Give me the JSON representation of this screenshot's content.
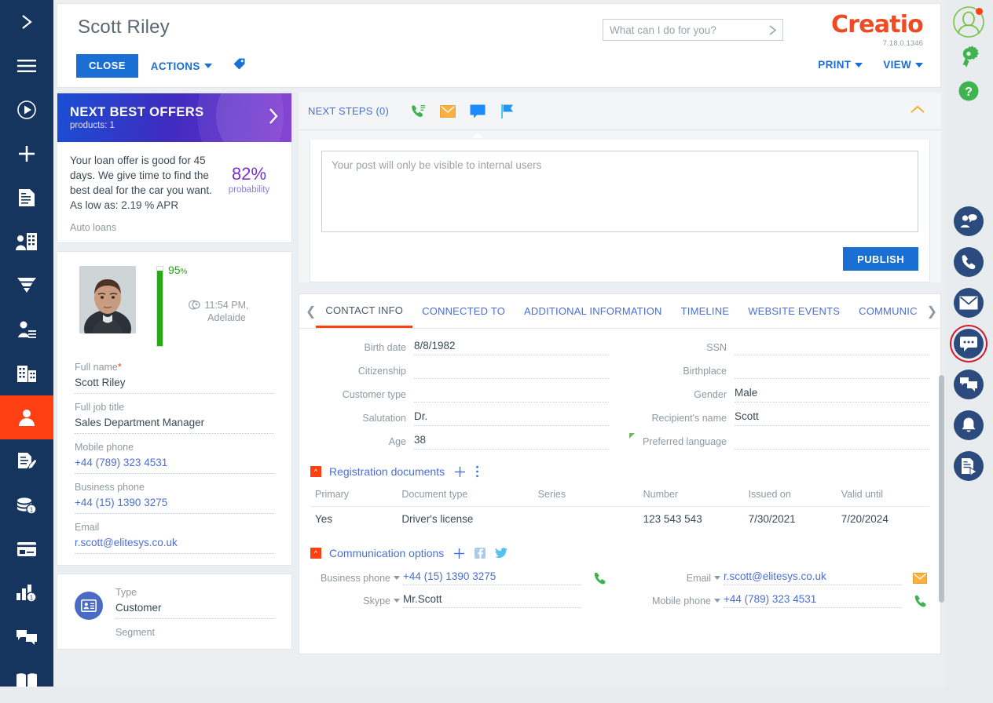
{
  "header": {
    "title": "Scott Riley",
    "close_label": "CLOSE",
    "actions_label": "ACTIONS",
    "tag_icon": "tag-icon",
    "print_label": "PRINT",
    "view_label": "VIEW"
  },
  "search": {
    "placeholder": "What can I do for you?",
    "value": "",
    "submit_icon": "chevron-right-icon"
  },
  "brand": {
    "name": "Creatio",
    "version": "7.18.0.1346"
  },
  "offers": {
    "title": "NEXT BEST OFFERS",
    "subtitle": "products: 1",
    "next_icon": "chevron-right-icon",
    "text": "Your loan offer is good for 45 days. We give time to find the best deal for the car you want. As low as: 2.19 % APR",
    "probability": "82%",
    "probability_label": "probability",
    "category": "Auto loans",
    "accent": "#7b2fd0"
  },
  "profile": {
    "completeness": "95",
    "completeness_suffix": "%",
    "local_time": "11:54 PM,",
    "local_city": "Adelaide",
    "fields": [
      {
        "label": "Full name",
        "required": true,
        "value": "Scott Riley",
        "link": false
      },
      {
        "label": "Full job title",
        "required": false,
        "value": "Sales Department Manager",
        "link": false
      },
      {
        "label": "Mobile phone",
        "required": false,
        "value": "+44 (789) 323 4531",
        "link": true
      },
      {
        "label": "Business phone",
        "required": false,
        "value": "+44 (15) 1390 3275",
        "link": true
      },
      {
        "label": "Email",
        "required": false,
        "value": "r.scott@elitesys.co.uk",
        "link": true
      }
    ]
  },
  "type_card": {
    "icon": "id-card-icon",
    "fields": [
      {
        "label": "Type",
        "value": "Customer"
      },
      {
        "label": "Segment",
        "value": ""
      }
    ]
  },
  "feed": {
    "next_steps_label": "NEXT STEPS (0)",
    "icons": [
      "call-icon",
      "email-icon",
      "message-icon",
      "flag-icon"
    ],
    "selected_icon": "message-icon",
    "collapse_icon": "chevron-up-icon",
    "post_placeholder": "Your post will only be visible to internal users",
    "post_value": "",
    "publish_label": "PUBLISH"
  },
  "tabs": {
    "prev_icon": "chevron-left-icon",
    "next_icon": "chevron-right-icon",
    "items": [
      {
        "label": "CONTACT INFO",
        "active": true
      },
      {
        "label": "CONNECTED TO",
        "active": false
      },
      {
        "label": "ADDITIONAL INFORMATION",
        "active": false
      },
      {
        "label": "TIMELINE",
        "active": false
      },
      {
        "label": "WEBSITE EVENTS",
        "active": false
      },
      {
        "label": "COMMUNIC",
        "active": false
      }
    ]
  },
  "contact_info": {
    "left": [
      {
        "label": "Birth date",
        "value": "8/8/1982"
      },
      {
        "label": "Citizenship",
        "value": ""
      },
      {
        "label": "Customer type",
        "value": ""
      },
      {
        "label": "Salutation",
        "value": "Dr."
      },
      {
        "label": "Age",
        "value": "38"
      }
    ],
    "right": [
      {
        "label": "SSN",
        "value": ""
      },
      {
        "label": "Birthplace",
        "value": ""
      },
      {
        "label": "Gender",
        "value": "Male"
      },
      {
        "label": "Recipient's name",
        "value": "Scott"
      },
      {
        "label": "Preferred language",
        "value": "",
        "marker": true
      }
    ]
  },
  "registration_documents": {
    "title": "Registration documents",
    "add_icon": "plus-icon",
    "menu_icon": "kebab-menu-icon",
    "columns": [
      "Primary",
      "Document type",
      "Series",
      "Number",
      "Issued on",
      "Valid until"
    ],
    "rows": [
      [
        "Yes",
        "Driver's license",
        "",
        "123 543 543",
        "7/30/2021",
        "7/20/2024"
      ]
    ]
  },
  "communication_options": {
    "title": "Communication options",
    "add_icon": "plus-icon",
    "facebook_icon": "facebook-icon",
    "twitter_icon": "twitter-icon",
    "left": [
      {
        "label": "Business phone",
        "value": "+44 (15) 1390 3275",
        "action": "call-icon"
      },
      {
        "label": "Skype",
        "value": "Mr.Scott",
        "action": ""
      }
    ],
    "right": [
      {
        "label": "Email",
        "value": "r.scott@elitesys.co.uk",
        "action": "email-icon"
      },
      {
        "label": "Mobile phone",
        "value": "+44 (789) 323 4531",
        "action": "call-icon"
      }
    ]
  },
  "left_sidebar": {
    "background": "#15355e",
    "active_color": "#ff4013",
    "items": [
      {
        "name": "expand-icon",
        "active": false
      },
      {
        "name": "menu-icon",
        "active": false
      },
      {
        "name": "run-process-icon",
        "active": false
      },
      {
        "name": "add-icon",
        "active": false
      },
      {
        "name": "activities-icon",
        "active": false
      },
      {
        "name": "accounts-icon",
        "active": false
      },
      {
        "name": "leads-funnel-icon",
        "active": false
      },
      {
        "name": "contacts-list-icon",
        "active": false
      },
      {
        "name": "companies-icon",
        "active": false
      },
      {
        "name": "contacts-icon",
        "active": true
      },
      {
        "name": "cases-icon",
        "active": false
      },
      {
        "name": "opportunities-icon",
        "active": false
      },
      {
        "name": "payments-icon",
        "active": false
      },
      {
        "name": "analytics-icon",
        "active": false
      },
      {
        "name": "feed-icon",
        "active": false
      },
      {
        "name": "knowledge-base-icon",
        "active": false
      }
    ]
  },
  "right_sidebar": {
    "top_items": [
      {
        "name": "user-profile-icon",
        "badge": true
      },
      {
        "name": "gear-icon",
        "badge": false
      },
      {
        "name": "help-icon",
        "badge": false
      }
    ],
    "comm_items": [
      {
        "name": "agent-chat-icon",
        "selected": false
      },
      {
        "name": "phone-icon",
        "selected": false
      },
      {
        "name": "email-icon",
        "selected": false
      },
      {
        "name": "chat-icon",
        "selected": true
      },
      {
        "name": "messages-icon",
        "selected": false
      },
      {
        "name": "notifications-icon",
        "selected": false
      },
      {
        "name": "process-log-icon",
        "selected": false
      }
    ]
  }
}
